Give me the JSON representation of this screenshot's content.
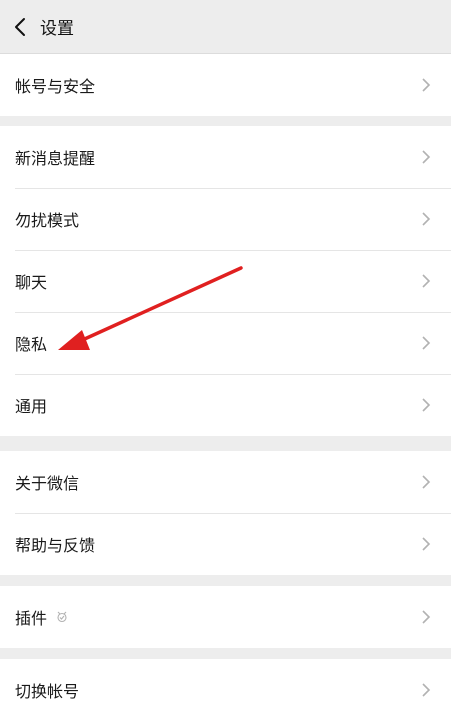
{
  "header": {
    "title": "设置",
    "back_icon": "chevron-left-icon"
  },
  "sections": [
    {
      "items": [
        {
          "label": "帐号与安全"
        }
      ]
    },
    {
      "items": [
        {
          "label": "新消息提醒"
        },
        {
          "label": "勿扰模式"
        },
        {
          "label": "聊天"
        },
        {
          "label": "隐私"
        },
        {
          "label": "通用"
        }
      ]
    },
    {
      "items": [
        {
          "label": "关于微信"
        },
        {
          "label": "帮助与反馈"
        }
      ]
    },
    {
      "items": [
        {
          "label": "插件",
          "icon": "plugin-icon"
        }
      ]
    },
    {
      "items": [
        {
          "label": "切换帐号"
        }
      ]
    }
  ],
  "annotation": {
    "type": "arrow",
    "color": "#e02020",
    "points_to": "隐私"
  },
  "colors": {
    "background": "#ededed",
    "row_background": "#ffffff",
    "divider": "#e5e5e5",
    "chevron": "#b2b2b2",
    "arrow": "#e02020"
  }
}
